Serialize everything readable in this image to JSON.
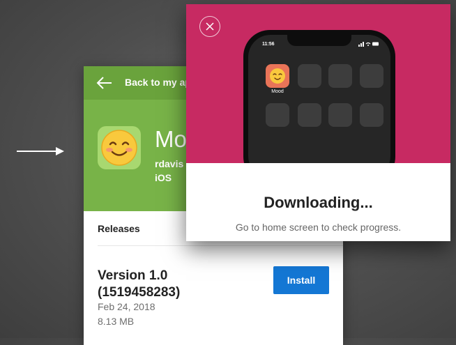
{
  "app": {
    "back_label": "Back to my apps",
    "name": "Mood",
    "owner": "rdavis",
    "platform": "iOS",
    "releases_label": "Releases",
    "release": {
      "version": "Version 1.0 (1519458283)",
      "date": "Feb 24, 2018",
      "size": "8.13 MB",
      "install_label": "Install"
    },
    "header_color": "#78b348"
  },
  "modal": {
    "title": "Downloading...",
    "subtitle": "Go to home screen to check progress.",
    "hero_color": "#c72a62",
    "phone": {
      "status_time": "11:56",
      "app_label": "Mood"
    }
  },
  "icons": {
    "arrow": "right-arrow-icon",
    "back": "back-arrow-icon",
    "close": "close-icon",
    "app": "smiling-face-icon"
  },
  "colors": {
    "install_button": "#1477d4"
  }
}
